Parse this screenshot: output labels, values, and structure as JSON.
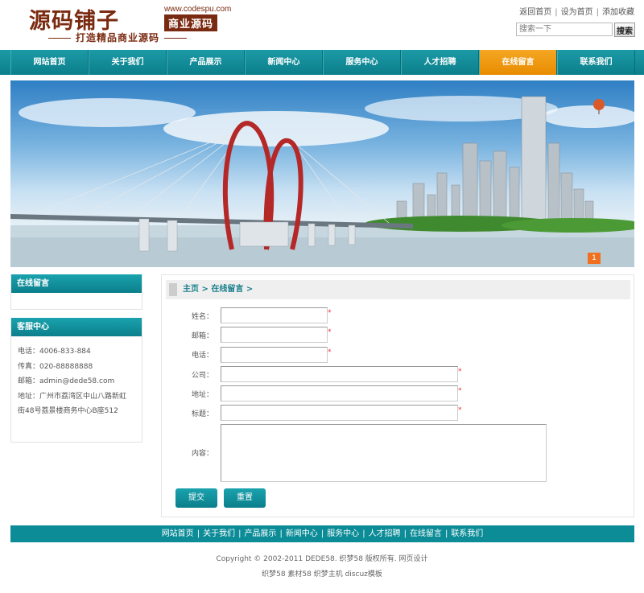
{
  "header": {
    "logo_main": "源码铺子",
    "logo_url": "www.codespu.com",
    "logo_badge": "商业源码",
    "logo_slogan": "打造精品商业源码",
    "top_links": [
      "返回首页",
      "设为首页",
      "添加收藏"
    ],
    "search_placeholder": "搜索一下",
    "search_button": "搜索"
  },
  "nav": {
    "items": [
      "网站首页",
      "关于我们",
      "产品展示",
      "新闻中心",
      "服务中心",
      "人才招聘",
      "在线留言",
      "联系我们"
    ],
    "active_index": 6,
    "active_color": "#f5a623",
    "bar_color": "#0b8c97"
  },
  "banner": {
    "page_indicator": "1"
  },
  "sidebar": {
    "box1_title": "在线留言",
    "box2_title": "客服中心",
    "contact": {
      "phone": "电话：4006-833-884",
      "fax": "传真：020-88888888",
      "email": "邮箱：admin@dede58.com",
      "address_line1": "地址：广州市荔湾区中山八路新虹",
      "address_line2": "街48号荔景楼商务中心B座512"
    }
  },
  "main": {
    "breadcrumb": "主页 > 在线留言 >",
    "form": {
      "name_label": "姓名：",
      "email_label": "邮箱：",
      "phone_label": "电话：",
      "company_label": "公司：",
      "address_label": "地址：",
      "subject_label": "标题：",
      "content_label": "内容：",
      "required_mark": "*",
      "submit_label": "提交",
      "reset_label": "重置"
    }
  },
  "footer": {
    "nav_items": [
      "网站首页",
      "关于我们",
      "产品展示",
      "新闻中心",
      "服务中心",
      "人才招聘",
      "在线留言",
      "联系我们"
    ],
    "copyright": "Copyright © 2002-2011 DEDE58. 织梦58 版权所有. 网页设计",
    "links_line": "织梦58 素材58 织梦主机 discuz模板"
  }
}
